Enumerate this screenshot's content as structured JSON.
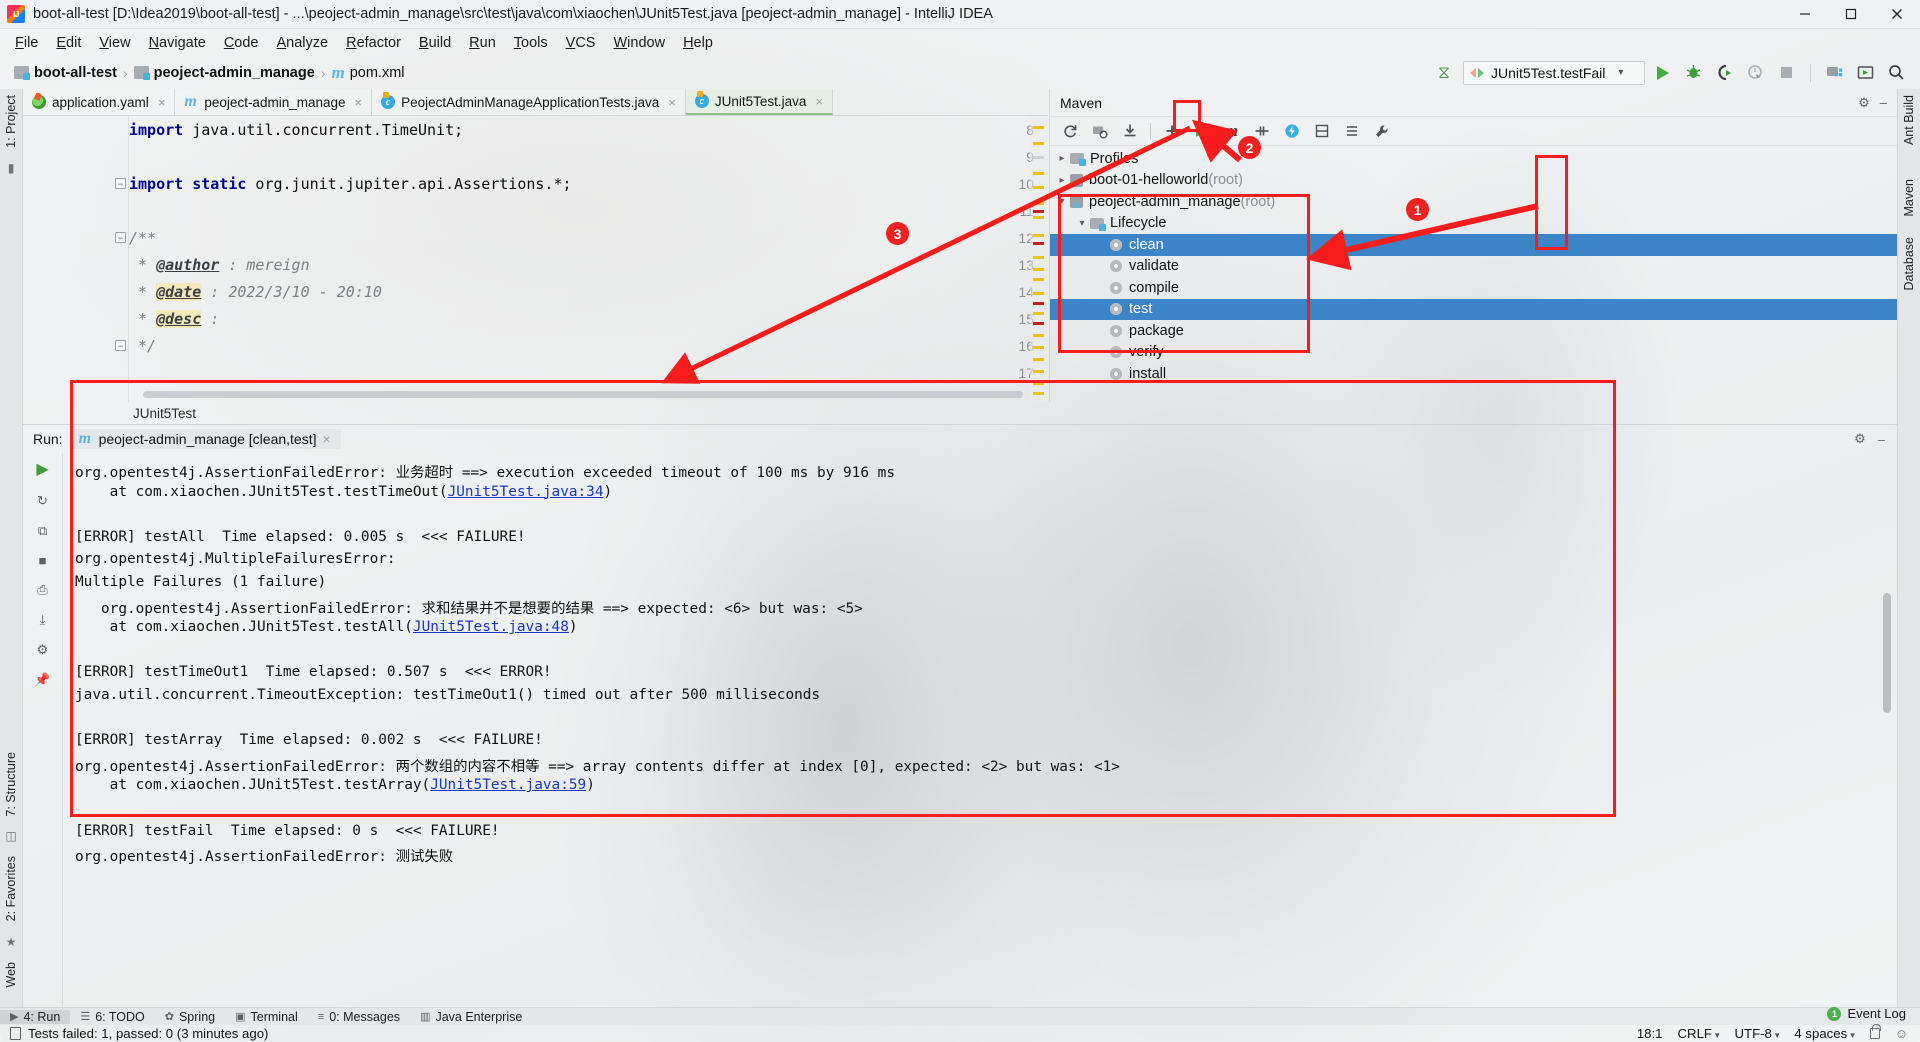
{
  "window": {
    "title": "boot-all-test [D:\\Idea2019\\boot-all-test] - ...\\peoject-admin_manage\\src\\test\\java\\com\\xiaochen\\JUnit5Test.java [peoject-admin_manage] - IntelliJ IDEA",
    "app_icon": "intellij-idea-icon",
    "minimize": "—",
    "maximize": "▢",
    "close": "✕"
  },
  "menu": [
    {
      "label": "File"
    },
    {
      "label": "Edit"
    },
    {
      "label": "View"
    },
    {
      "label": "Navigate"
    },
    {
      "label": "Code"
    },
    {
      "label": "Analyze"
    },
    {
      "label": "Refactor"
    },
    {
      "label": "Build"
    },
    {
      "label": "Run"
    },
    {
      "label": "Tools"
    },
    {
      "label": "VCS"
    },
    {
      "label": "Window"
    },
    {
      "label": "Help"
    }
  ],
  "navbar": {
    "breadcrumbs": [
      {
        "label": "boot-all-test",
        "icon": "module-icon"
      },
      {
        "label": "peoject-admin_manage",
        "icon": "module-icon"
      },
      {
        "label": "pom.xml",
        "icon": "maven-m-icon"
      }
    ],
    "separator": "›",
    "run_config": {
      "label": "JUnit5Test.testFail",
      "icon": "run-config-icon",
      "chevron": "⌄"
    },
    "buttons": [
      {
        "name": "build-hammer-icon",
        "glyph": "✐"
      },
      {
        "name": "run-button",
        "glyph": "run-triangle"
      },
      {
        "name": "debug-button",
        "glyph": "🐞"
      },
      {
        "name": "run-with-coverage-button",
        "glyph": "C"
      },
      {
        "name": "profile-button",
        "glyph": "◴"
      },
      {
        "name": "stop-button",
        "glyph": "■"
      },
      {
        "name": "project-structure-button",
        "glyph": "▤"
      },
      {
        "name": "avd-manager-button",
        "glyph": "▶"
      },
      {
        "name": "search-everywhere-button",
        "glyph": "🔍"
      }
    ]
  },
  "left_strip": [
    {
      "label": "1: Project",
      "name": "tool-window-project"
    },
    {
      "label": "7: Structure",
      "name": "tool-window-structure"
    },
    {
      "label": "2: Favorites",
      "name": "tool-window-favorites"
    },
    {
      "label": "Web",
      "name": "tool-window-web"
    }
  ],
  "right_strip": [
    {
      "label": "Ant Build",
      "name": "tool-window-ant-build"
    },
    {
      "label": "Maven",
      "name": "tool-window-maven"
    },
    {
      "label": "Database",
      "name": "tool-window-database"
    }
  ],
  "editor": {
    "tabs": [
      {
        "label": "application.yaml",
        "icon": "yaml-file-icon",
        "active": false
      },
      {
        "label": "peoject-admin_manage",
        "icon": "maven-m-icon",
        "active": false
      },
      {
        "label": "PeojectAdminManageApplicationTests.java",
        "icon": "java-class-icon",
        "active": false
      },
      {
        "label": "JUnit5Test.java",
        "icon": "java-class-icon",
        "active": true
      }
    ],
    "close_glyph": "×",
    "lines": [
      {
        "num": "8",
        "html": "<span class=\"kw\">import</span> java.util.concurrent.TimeUnit;"
      },
      {
        "num": "9",
        "html": ""
      },
      {
        "num": "10",
        "html": "<span class=\"kw\">import static</span> org.junit.jupiter.api.Assertions.*;",
        "fold": true
      },
      {
        "num": "11",
        "html": ""
      },
      {
        "num": "12",
        "html": "<span class=\"cmt\">/**</span>",
        "fold": true
      },
      {
        "num": "13",
        "html": "<span class=\"cmt\"> * </span><span class=\"jdoc-tag\">@author</span><span class=\"cmt\"> : mereign</span>"
      },
      {
        "num": "14",
        "html": "<span class=\"cmt\"> * </span><span class=\"jdoc-tag hl\">@date</span><span class=\"cmt\"> : 2022/3/10 - 20:10</span>"
      },
      {
        "num": "15",
        "html": "<span class=\"cmt\"> * </span><span class=\"jdoc-tag hl\">@desc</span><span class=\"cmt\"> :</span>"
      },
      {
        "num": "16",
        "html": "<span class=\"cmt\"> */</span>",
        "fold": true
      },
      {
        "num": "17",
        "html": ""
      }
    ],
    "breadcrumb": "JUnit5Test"
  },
  "maven": {
    "title": "Maven",
    "settings_icon": "gear-icon",
    "hide_icon": "minimize-icon",
    "toolbar": [
      {
        "name": "reimport-button",
        "glyph": "↻"
      },
      {
        "name": "generate-sources-button",
        "glyph": "📁"
      },
      {
        "name": "download-sources-button",
        "glyph": "⤓"
      },
      {
        "name": "add-maven-project-button",
        "glyph": "+"
      },
      {
        "name": "run-maven-build-button",
        "glyph": "run-triangle",
        "highlighted": true
      },
      {
        "name": "execute-maven-goal-button",
        "glyph": "m"
      },
      {
        "name": "toggle-offline-button",
        "glyph": "⫫"
      },
      {
        "name": "toggle-skip-tests-button",
        "glyph": "⚡"
      },
      {
        "name": "collapse-all-button",
        "glyph": "⬍"
      },
      {
        "name": "expand-all-button",
        "glyph": "≡"
      },
      {
        "name": "maven-settings-button",
        "glyph": "🔧"
      }
    ],
    "tree": [
      {
        "label": "Profiles",
        "suffix": "",
        "icon": "profiles-folder-icon",
        "chevron": "›",
        "indent": 0,
        "selected": false
      },
      {
        "label": "boot-01-helloworld",
        "suffix": " (root)",
        "icon": "maven-module-icon",
        "chevron": "›",
        "indent": 0,
        "selected": false
      },
      {
        "label": "peoject-admin_manage",
        "suffix": " (root)",
        "icon": "maven-module-icon",
        "chevron": "⌄",
        "indent": 0,
        "selected": false
      },
      {
        "label": "Lifecycle",
        "suffix": "",
        "icon": "lifecycle-folder-icon",
        "chevron": "⌄",
        "indent": 1,
        "selected": false
      },
      {
        "label": "clean",
        "suffix": "",
        "icon": "maven-goal-icon",
        "chevron": "",
        "indent": 2,
        "selected": true
      },
      {
        "label": "validate",
        "suffix": "",
        "icon": "maven-goal-icon",
        "chevron": "",
        "indent": 2,
        "selected": false
      },
      {
        "label": "compile",
        "suffix": "",
        "icon": "maven-goal-icon",
        "chevron": "",
        "indent": 2,
        "selected": false
      },
      {
        "label": "test",
        "suffix": "",
        "icon": "maven-goal-icon",
        "chevron": "",
        "indent": 2,
        "selected": true
      },
      {
        "label": "package",
        "suffix": "",
        "icon": "maven-goal-icon",
        "chevron": "",
        "indent": 2,
        "selected": false
      },
      {
        "label": "verify",
        "suffix": "",
        "icon": "maven-goal-icon",
        "chevron": "",
        "indent": 2,
        "selected": false
      },
      {
        "label": "install",
        "suffix": "",
        "icon": "maven-goal-icon",
        "chevron": "",
        "indent": 2,
        "selected": false
      }
    ]
  },
  "run": {
    "label": "Run:",
    "tab": {
      "label": "peoject-admin_manage [clean,test]",
      "icon": "maven-m-icon",
      "close": "×"
    },
    "settings_icon": "gear-icon",
    "hide_icon": "minimize-icon",
    "sidebar": [
      {
        "name": "rerun-button",
        "glyph": "▶"
      },
      {
        "name": "rerun-failed-tests-button",
        "glyph": "↻"
      },
      {
        "name": "toggle-auto-test-button",
        "glyph": "⧉"
      },
      {
        "name": "stop-button",
        "glyph": "■"
      },
      {
        "name": "print-button",
        "glyph": "⎙"
      },
      {
        "name": "export-button",
        "glyph": "⤓"
      },
      {
        "name": "settings-button",
        "glyph": "⚙"
      },
      {
        "name": "pin-button",
        "glyph": "📌"
      }
    ],
    "console_lines": [
      {
        "text": "org.opentest4j.AssertionFailedError: 业务超时 ==> execution exceeded timeout of 100 ms by 916 ms"
      },
      {
        "text": "    at com.xiaochen.JUnit5Test.testTimeOut(",
        "link": "JUnit5Test.java:34",
        "tail": ")"
      },
      {
        "text": ""
      },
      {
        "text": "[ERROR] testAll  Time elapsed: 0.005 s  <<< FAILURE!"
      },
      {
        "text": "org.opentest4j.MultipleFailuresError:"
      },
      {
        "text": "Multiple Failures (1 failure)"
      },
      {
        "text": "   org.opentest4j.AssertionFailedError: 求和结果并不是想要的结果 ==> expected: <6> but was: <5>"
      },
      {
        "text": "    at com.xiaochen.JUnit5Test.testAll(",
        "link": "JUnit5Test.java:48",
        "tail": ")"
      },
      {
        "text": ""
      },
      {
        "text": "[ERROR] testTimeOut1  Time elapsed: 0.507 s  <<< ERROR!"
      },
      {
        "text": "java.util.concurrent.TimeoutException: testTimeOut1() timed out after 500 milliseconds"
      },
      {
        "text": ""
      },
      {
        "text": "[ERROR] testArray  Time elapsed: 0.002 s  <<< FAILURE!"
      },
      {
        "text": "org.opentest4j.AssertionFailedError: 两个数组的内容不相等 ==> array contents differ at index [0], expected: <2> but was: <1>"
      },
      {
        "text": "    at com.xiaochen.JUnit5Test.testArray(",
        "link": "JUnit5Test.java:59",
        "tail": ")"
      },
      {
        "text": ""
      },
      {
        "text": "[ERROR] testFail  Time elapsed: 0 s  <<< FAILURE!"
      },
      {
        "text": "org.opentest4j.AssertionFailedError: 测试失败"
      }
    ]
  },
  "bottom_strip": [
    {
      "label": "4: Run",
      "name": "tool-window-run",
      "glyph": "▶",
      "active": true
    },
    {
      "label": "6: TODO",
      "name": "tool-window-todo",
      "glyph": "☰",
      "active": false
    },
    {
      "label": "Spring",
      "name": "tool-window-spring",
      "glyph": "✿",
      "active": false
    },
    {
      "label": "Terminal",
      "name": "tool-window-terminal",
      "glyph": "▣",
      "active": false
    },
    {
      "label": "0: Messages",
      "name": "tool-window-messages",
      "glyph": "≡",
      "active": false
    },
    {
      "label": "Java Enterprise",
      "name": "tool-window-java-enterprise",
      "glyph": "▥",
      "active": false
    }
  ],
  "event_log": {
    "label": "Event Log",
    "badge": "1"
  },
  "status_bar": {
    "message": "Tests failed: 1, passed: 0 (3 minutes ago)",
    "caret": "18:1",
    "line_separator": "CRLF",
    "encoding": "UTF-8",
    "indent": "4 spaces",
    "lock_icon": "unlocked-icon",
    "inspector_icon": "inspector-icon",
    "spinner": "⬍"
  },
  "annotations": [
    {
      "number": "1",
      "name": "annotation-marker-1"
    },
    {
      "number": "2",
      "name": "annotation-marker-2"
    },
    {
      "number": "3",
      "name": "annotation-marker-3"
    }
  ],
  "colors": {
    "accent_red": "#f71d1d",
    "selection_blue": "#3c84c8",
    "run_green": "#44aa44",
    "link_blue": "#1a36c9"
  }
}
